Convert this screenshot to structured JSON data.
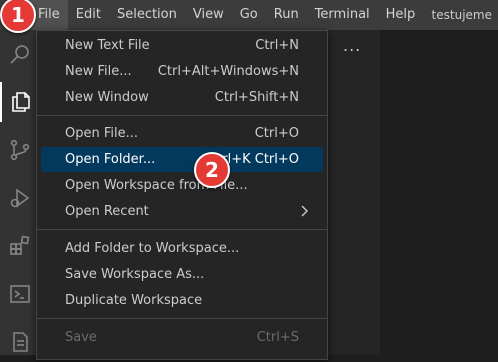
{
  "menubar": {
    "items": [
      "File",
      "Edit",
      "Selection",
      "View",
      "Go",
      "Run",
      "Terminal",
      "Help"
    ],
    "window_title": "testujeme"
  },
  "activity_icons": [
    "search-icon",
    "explorer-icon",
    "source-control-icon",
    "run-debug-icon",
    "extensions-icon",
    "terminal-icon",
    "document-icon"
  ],
  "editor": {
    "more_actions": "..."
  },
  "file_menu": {
    "items": [
      {
        "label": "New Text File",
        "shortcut": "Ctrl+N"
      },
      {
        "label": "New File...",
        "shortcut": "Ctrl+Alt+Windows+N"
      },
      {
        "label": "New Window",
        "shortcut": "Ctrl+Shift+N"
      },
      {
        "label": "Open File...",
        "shortcut": "Ctrl+O"
      },
      {
        "label": "Open Folder...",
        "shortcut": "Ctrl+K Ctrl+O"
      },
      {
        "label": "Open Workspace from File...",
        "shortcut": ""
      },
      {
        "label": "Open Recent",
        "shortcut": ""
      },
      {
        "label": "Add Folder to Workspace...",
        "shortcut": ""
      },
      {
        "label": "Save Workspace As...",
        "shortcut": ""
      },
      {
        "label": "Duplicate Workspace",
        "shortcut": ""
      },
      {
        "label": "Save",
        "shortcut": "Ctrl+S"
      }
    ]
  },
  "badges": [
    "1",
    "2"
  ],
  "colors": {
    "menu_highlight": "#04395e",
    "badge": "#e53935",
    "menubar_bg": "#3c3c3c",
    "activitybar_bg": "#333333"
  }
}
